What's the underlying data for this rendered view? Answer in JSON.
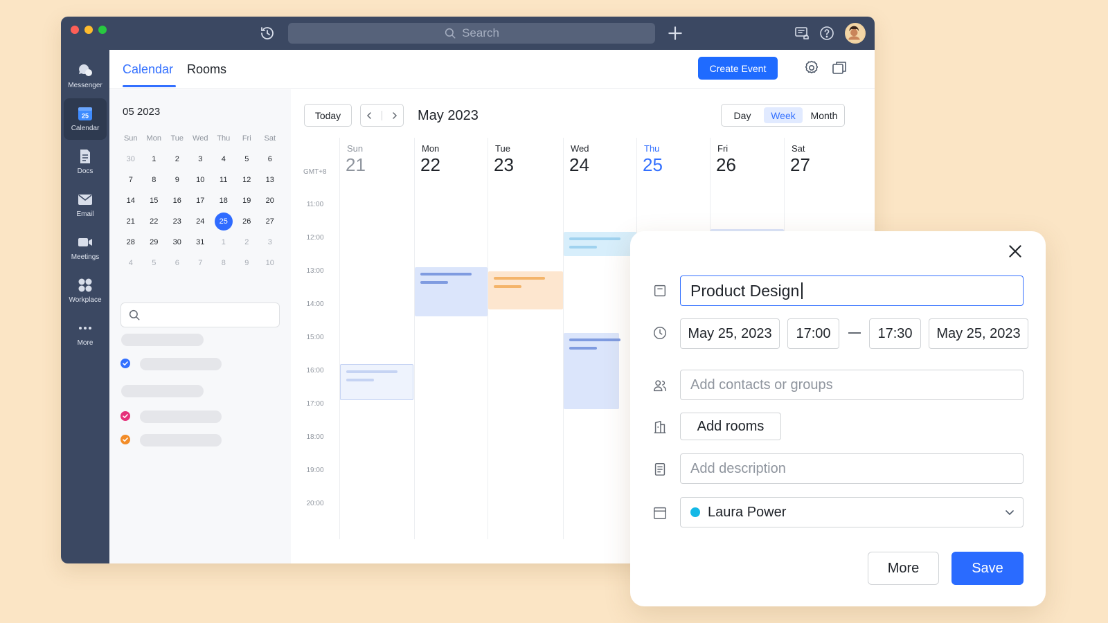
{
  "titlebar": {
    "search_placeholder": "Search"
  },
  "nav": [
    {
      "label": "Messenger",
      "icon": "messenger-icon"
    },
    {
      "label": "Calendar",
      "icon": "calendar-icon",
      "badge": "25"
    },
    {
      "label": "Docs",
      "icon": "docs-icon"
    },
    {
      "label": "Email",
      "icon": "email-icon"
    },
    {
      "label": "Meetings",
      "icon": "meetings-icon"
    },
    {
      "label": "Workplace",
      "icon": "workplace-icon"
    },
    {
      "label": "More",
      "icon": "more-dots-icon"
    }
  ],
  "tabs": {
    "calendar": "Calendar",
    "rooms": "Rooms"
  },
  "toolbar": {
    "create_event": "Create Event"
  },
  "mini_calendar": {
    "title": "05 2023",
    "weekdays": [
      "Sun",
      "Mon",
      "Tue",
      "Wed",
      "Thu",
      "Fri",
      "Sat"
    ],
    "weeks": [
      [
        "30",
        "1",
        "2",
        "3",
        "4",
        "5",
        "6"
      ],
      [
        "7",
        "8",
        "9",
        "10",
        "11",
        "12",
        "13"
      ],
      [
        "14",
        "15",
        "16",
        "17",
        "18",
        "19",
        "20"
      ],
      [
        "21",
        "22",
        "23",
        "24",
        "25",
        "26",
        "27"
      ],
      [
        "28",
        "29",
        "30",
        "31",
        "1",
        "2",
        "3"
      ],
      [
        "4",
        "5",
        "6",
        "7",
        "8",
        "9",
        "10"
      ]
    ],
    "selected": "25"
  },
  "week_view": {
    "today_label": "Today",
    "month_title": "May 2023",
    "views": {
      "day": "Day",
      "week": "Week",
      "month": "Month",
      "active": "Week"
    },
    "timezone": "GMT+8",
    "hours": [
      "11:00",
      "12:00",
      "13:00",
      "14:00",
      "15:00",
      "16:00",
      "17:00",
      "18:00",
      "19:00",
      "20:00"
    ],
    "days": [
      {
        "name": "Sun",
        "num": "21"
      },
      {
        "name": "Mon",
        "num": "22"
      },
      {
        "name": "Tue",
        "num": "23"
      },
      {
        "name": "Wed",
        "num": "24"
      },
      {
        "name": "Thu",
        "num": "25"
      },
      {
        "name": "Fri",
        "num": "26"
      },
      {
        "name": "Sat",
        "num": "27"
      }
    ]
  },
  "colors": {
    "accent": "#3370ff",
    "event_blue": "#dbe5fb",
    "event_blue_bar": "#7f9be0",
    "event_cyan": "#d7eefb",
    "event_cyan_bar": "#9fd2ef",
    "event_orange": "#fde6cf",
    "event_orange_bar": "#f4b46a",
    "calendar_dot": "#14b8e6",
    "check_blue": "#3370ff",
    "check_pink": "#e5317a",
    "check_orange": "#f28c28"
  },
  "dialog": {
    "title_value": "Product Design",
    "start_date": "May 25, 2023",
    "start_time": "17:00",
    "end_time": "17:30",
    "end_date": "May 25, 2023",
    "contacts_placeholder": "Add contacts or groups",
    "add_rooms": "Add rooms",
    "description_placeholder": "Add description",
    "calendar_owner": "Laura Power",
    "more_label": "More",
    "save_label": "Save"
  }
}
